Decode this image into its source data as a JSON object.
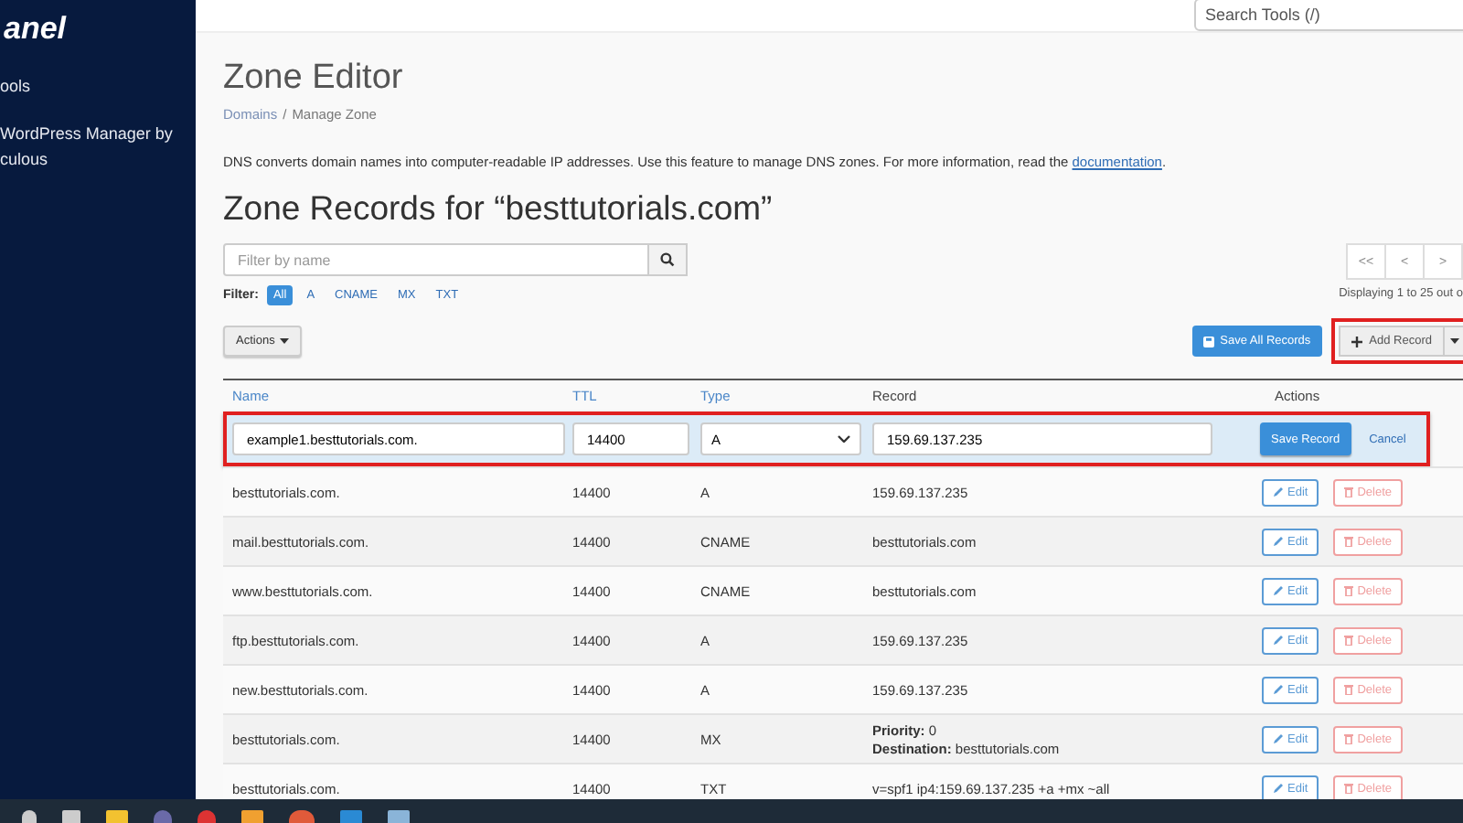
{
  "sidebar": {
    "logo": "anel",
    "items": [
      {
        "label": "ools"
      },
      {
        "label": "WordPress Manager by culous"
      }
    ]
  },
  "header": {
    "search": {
      "placeholder": "Search Tools (/)"
    }
  },
  "page": {
    "title": "Zone Editor",
    "breadcrumbs": [
      {
        "label": "Domains",
        "link": true
      },
      {
        "label": "Manage Zone",
        "link": false
      }
    ],
    "breadcrumb_separator": "/",
    "description": "DNS converts domain names into computer-readable IP addresses. Use this feature to manage DNS zones. For more information, read the ",
    "description_link": "documentation",
    "description_end": "."
  },
  "zone": {
    "heading": "Zone Records for “besttutorials.com”",
    "filter_field": {
      "placeholder": "Filter by name"
    },
    "filter_label": "Filter:",
    "filters": [
      {
        "label": "All",
        "selected": true
      },
      {
        "label": "A",
        "selected": false
      },
      {
        "label": "CNAME",
        "selected": false
      },
      {
        "label": "MX",
        "selected": false
      },
      {
        "label": "TXT",
        "selected": false
      }
    ],
    "pagination": [
      "<<",
      "<",
      ">"
    ],
    "displaying": "Displaying 1 to 25 out o",
    "actions_button": "Actions",
    "save_all": "Save All Records",
    "add_record": "Add Record"
  },
  "table": {
    "columns": [
      {
        "label": "Name",
        "sortable": true
      },
      {
        "label": "TTL",
        "sortable": true
      },
      {
        "label": "Type",
        "sortable": true
      },
      {
        "label": "Record",
        "sortable": false
      },
      {
        "label": "Actions",
        "sortable": false
      }
    ],
    "edit_row": {
      "name": "example1.besttutorials.com.",
      "ttl": "14400",
      "type": "A",
      "record": "159.69.137.235",
      "save": "Save Record",
      "cancel": "Cancel"
    },
    "rows": [
      {
        "name": "besttutorials.com.",
        "ttl": "14400",
        "type": "A",
        "record": [
          "159.69.137.235"
        ],
        "edit": "Edit",
        "delete": "Delete"
      },
      {
        "name": "mail.besttutorials.com.",
        "ttl": "14400",
        "type": "CNAME",
        "record": [
          "besttutorials.com"
        ],
        "edit": "Edit",
        "delete": "Delete"
      },
      {
        "name": "www.besttutorials.com.",
        "ttl": "14400",
        "type": "CNAME",
        "record": [
          "besttutorials.com"
        ],
        "edit": "Edit",
        "delete": "Delete"
      },
      {
        "name": "ftp.besttutorials.com.",
        "ttl": "14400",
        "type": "A",
        "record": [
          "159.69.137.235"
        ],
        "edit": "Edit",
        "delete": "Delete"
      },
      {
        "name": "new.besttutorials.com.",
        "ttl": "14400",
        "type": "A",
        "record": [
          "159.69.137.235"
        ],
        "edit": "Edit",
        "delete": "Delete"
      },
      {
        "name": "besttutorials.com.",
        "ttl": "14400",
        "type": "MX",
        "record": [
          "**Priority:** 0",
          "**Destination:** besttutorials.com"
        ],
        "edit": "Edit",
        "delete": "Delete"
      },
      {
        "name": "besttutorials.com.",
        "ttl": "14400",
        "type": "TXT",
        "record": [
          "v=spf1 ip4:159.69.137.235 +a +mx ~all"
        ],
        "edit": "Edit",
        "delete": "Delete"
      }
    ]
  }
}
